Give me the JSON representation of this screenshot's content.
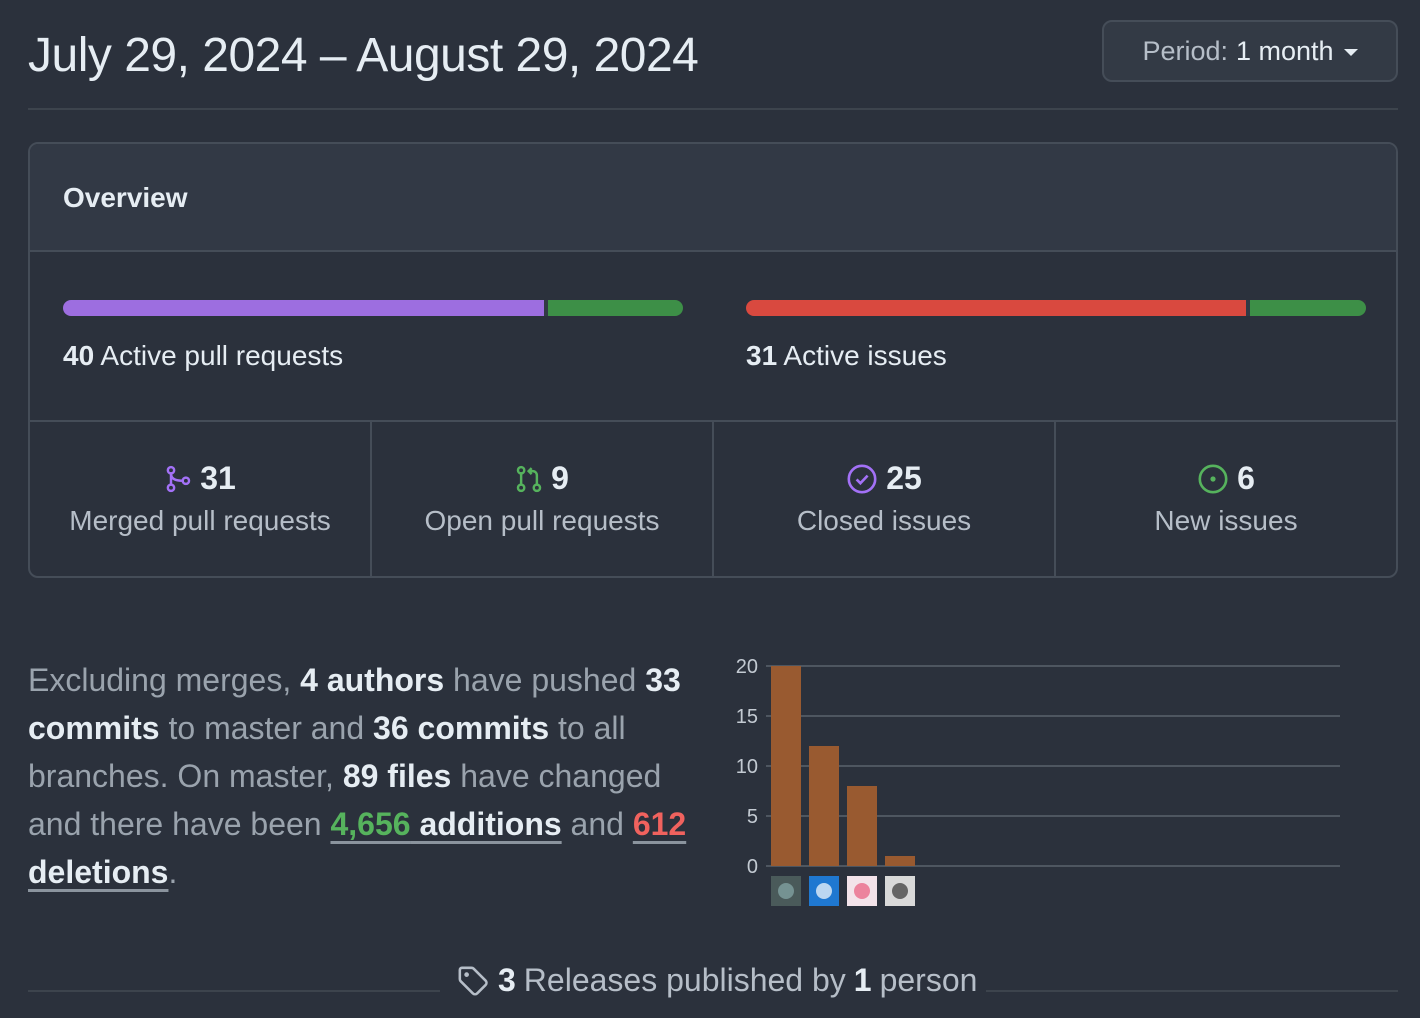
{
  "header": {
    "date_range": "July 29, 2024 – August 29, 2024",
    "period_label": "Period:",
    "period_value": "1 month"
  },
  "overview": {
    "title": "Overview",
    "pull_requests": {
      "count": "40",
      "label": "Active pull requests",
      "merged_fraction": 0.775,
      "colors": {
        "merged": "#9d6ee0",
        "open": "#3d8f47"
      }
    },
    "issues": {
      "count": "31",
      "label": "Active issues",
      "closed_fraction": 0.806,
      "colors": {
        "closed": "#d9493f",
        "new": "#3d8f47"
      }
    },
    "stats": [
      {
        "icon": "git-merge-icon",
        "value": "31",
        "label": "Merged pull requests",
        "color": "#a371f7"
      },
      {
        "icon": "git-pull-request-icon",
        "value": "9",
        "label": "Open pull requests",
        "color": "#56b35d"
      },
      {
        "icon": "issue-closed-icon",
        "value": "25",
        "label": "Closed issues",
        "color": "#a371f7"
      },
      {
        "icon": "issue-opened-icon",
        "value": "6",
        "label": "New issues",
        "color": "#56b35d"
      }
    ]
  },
  "summary": {
    "t1": "Excluding merges, ",
    "authors": "4 authors",
    "t2": " have pushed ",
    "commits_master": "33 commits",
    "t3": " to master and ",
    "commits_all": "36 commits",
    "t4": " to all branches. On master, ",
    "files": "89 files",
    "t5": " have changed and there have been ",
    "additions_num": "4,656",
    "additions_word": " additions",
    "t6": " and ",
    "deletions_num": "612",
    "deletions_word": " deletions",
    "t7": "."
  },
  "chart_data": {
    "type": "bar",
    "categories": [
      "author-1",
      "author-2",
      "author-3",
      "author-4"
    ],
    "values": [
      20,
      12,
      8,
      1
    ],
    "ylim": [
      0,
      20
    ],
    "yticks": [
      0,
      5,
      10,
      15,
      20
    ],
    "bar_color": "#995a30",
    "grid": true
  },
  "releases": {
    "count": "3",
    "text1": "Releases published by",
    "people": "1",
    "text2": "person"
  }
}
